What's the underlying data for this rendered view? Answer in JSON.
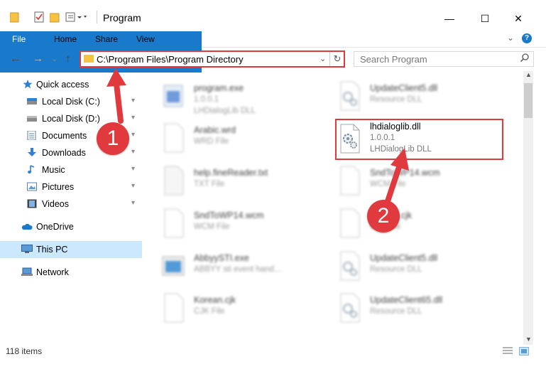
{
  "window": {
    "title": "Program",
    "minimize_glyph": "—",
    "maximize_glyph": "☐",
    "close_glyph": "✕"
  },
  "ribbon": {
    "tabs": [
      "File",
      "Home",
      "Share",
      "View"
    ],
    "expand_glyph": "⌄",
    "help_glyph": "?"
  },
  "address": {
    "back_glyph": "←",
    "forward_glyph": "→",
    "recent_glyph": "⌄",
    "up_glyph": "↑",
    "path": "C:\\Program Files\\Program Directory",
    "dropdown_glyph": "⌄",
    "refresh_glyph": "↻"
  },
  "search": {
    "placeholder": "Search Program",
    "icon": "search-icon"
  },
  "sidebar": {
    "items": [
      {
        "label": "Quick access",
        "icon": "star-icon",
        "pinned": false
      },
      {
        "label": "Local Disk (C:)",
        "icon": "drive-icon",
        "pinned": true
      },
      {
        "label": "Local Disk (D:)",
        "icon": "drive-icon",
        "pinned": true
      },
      {
        "label": "Documents",
        "icon": "documents-icon",
        "pinned": true
      },
      {
        "label": "Downloads",
        "icon": "download-icon",
        "pinned": true
      },
      {
        "label": "Music",
        "icon": "music-icon",
        "pinned": true
      },
      {
        "label": "Pictures",
        "icon": "pictures-icon",
        "pinned": true
      },
      {
        "label": "Videos",
        "icon": "videos-icon",
        "pinned": true
      },
      {
        "label": "OneDrive",
        "icon": "cloud-icon",
        "pinned": false
      },
      {
        "label": "This PC",
        "icon": "computer-icon",
        "pinned": false
      },
      {
        "label": "Network",
        "icon": "network-icon",
        "pinned": false
      }
    ],
    "pin_glyph": "📌"
  },
  "files": [
    {
      "name": "program.exe",
      "sub1": "1.0.0.1",
      "sub2": "LHDialogLib DLL",
      "icon": "exe-icon",
      "blurred": true
    },
    {
      "name": "UpdateClient5.dll",
      "sub1": "Resource DLL",
      "sub2": "",
      "icon": "dll-icon",
      "blurred": true
    },
    {
      "name": "Arabic.wrd",
      "sub1": "WRD File",
      "sub2": "",
      "icon": "file-icon",
      "blurred": true
    },
    {
      "name": "lhdialoglib.dll",
      "sub1": "1.0.0.1",
      "sub2": "LHDialogLib DLL",
      "icon": "dll-icon",
      "blurred": false
    },
    {
      "name": "help.fineReader.txt",
      "sub1": "TXT File",
      "sub2": "",
      "icon": "txt-icon",
      "blurred": true
    },
    {
      "name": "SndToWP14.wcm",
      "sub1": "WCM File",
      "sub2": "",
      "icon": "file-icon",
      "blurred": true
    },
    {
      "name": "SndToWP14.wcm",
      "sub1": "WCM File",
      "sub2": "",
      "icon": "file-icon",
      "blurred": true
    },
    {
      "name": "Korean.cjk",
      "sub1": "CJK File",
      "sub2": "",
      "icon": "file-icon",
      "blurred": true
    },
    {
      "name": "AbbyySTI.exe",
      "sub1": "ABBYY sti event hand...",
      "sub2": "",
      "icon": "exe-icon",
      "blurred": true
    },
    {
      "name": "UpdateClient5.dll",
      "sub1": "Resource DLL",
      "sub2": "",
      "icon": "dll-icon",
      "blurred": true
    },
    {
      "name": "Korean.cjk",
      "sub1": "CJK File",
      "sub2": "",
      "icon": "file-icon",
      "blurred": true
    },
    {
      "name": "UpdateClient65.dll",
      "sub1": "Resource DLL",
      "sub2": "",
      "icon": "dll-icon",
      "blurred": true
    }
  ],
  "annotations": {
    "step1": "1",
    "step2": "2",
    "color": "#e0393e"
  },
  "status": {
    "item_count": "118 items"
  },
  "colors": {
    "accent": "#1979ca",
    "selection": "#cce8ff",
    "folder": "#f5c242"
  }
}
